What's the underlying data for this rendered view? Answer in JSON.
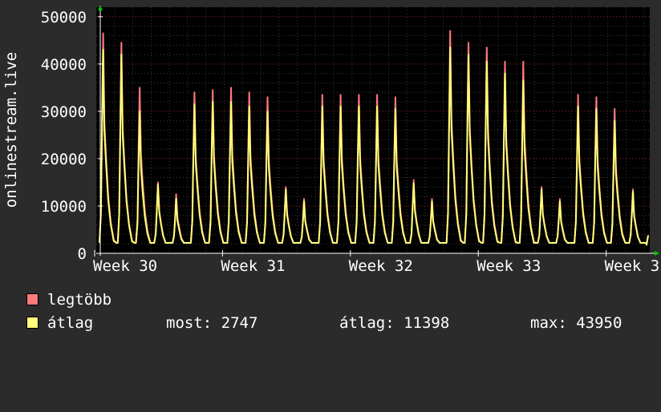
{
  "chart_data": {
    "type": "line",
    "ylabel": "onlinestream.live",
    "ylim": [
      0,
      52000
    ],
    "y_ticks": [
      "0",
      "10000",
      "20000",
      "30000",
      "40000",
      "50000"
    ],
    "x_tick_labels": [
      "Week 30",
      "Week 31",
      "Week 32",
      "Week 33",
      "Week 3"
    ],
    "grid": true,
    "legend_placement": "bottom-left",
    "colors": {
      "background": "#2b2b2b",
      "plot_background": "#000000",
      "grid": "#3a3a3a",
      "grid_major": "#551818",
      "max_series": "#ff7a7a",
      "avg_series": "#ffff7a",
      "axis_arrows": "#00cc00"
    },
    "daily_peaks": {
      "legtobb": [
        46500,
        44500,
        35000,
        15000,
        12500,
        34000,
        34500,
        35000,
        34000,
        33000,
        14000,
        11500,
        33500,
        33500,
        33500,
        33500,
        33000,
        15500,
        11500,
        47000,
        44500,
        43500,
        40500,
        40500,
        14000,
        11500,
        33500,
        33000,
        30500,
        13500
      ],
      "atlag": [
        43000,
        42000,
        30000,
        14500,
        11500,
        31500,
        32000,
        32000,
        31000,
        30000,
        13500,
        11000,
        31000,
        31000,
        31000,
        31000,
        30500,
        14800,
        11000,
        43500,
        42000,
        40500,
        38000,
        36500,
        13500,
        11000,
        31000,
        30500,
        28000,
        13000
      ]
    },
    "series": [
      {
        "name": "legtöbb",
        "color": "#ff7a7a"
      },
      {
        "name": "átlag",
        "color": "#ffff7a"
      }
    ]
  },
  "legend": {
    "max_label": "legtöbb",
    "avg_label": "átlag",
    "now_text": "most: 2747",
    "avg_text": "átlag: 11398",
    "max_text": "max: 43950"
  }
}
